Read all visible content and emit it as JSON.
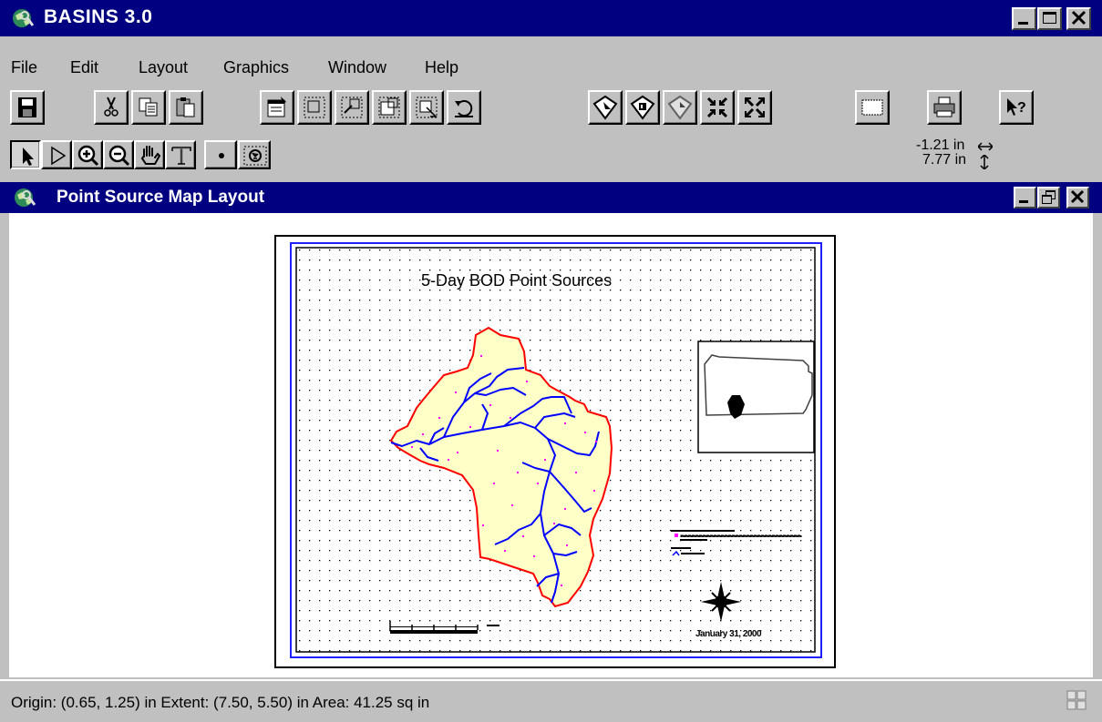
{
  "app": {
    "title": "BASINS 3.0"
  },
  "menu": [
    "File",
    "Edit",
    "Layout",
    "Graphics",
    "Window",
    "Help"
  ],
  "coords": {
    "x": "-1.21 in",
    "y": "7.77 in"
  },
  "child_window": {
    "title": "Point Source Map Layout"
  },
  "layout": {
    "map_title": "5-Day BOD Point Sources",
    "date": "January 31, 2000"
  },
  "status": {
    "text": "Origin: (0.65, 1.25) in  Extent: (7.50, 5.50) in  Area: 41.25 sq in"
  },
  "colors": {
    "titlebar": "#000080",
    "chrome": "#c0c0c0",
    "watershed_fill": "#ffffc8",
    "watershed_outline": "#ff0000",
    "river": "#0000ff",
    "point_source": "#ff00ff"
  },
  "toolbar_icons": [
    "save-icon",
    "cut-icon",
    "copy-icon",
    "paste-icon",
    "properties-icon",
    "group-icon",
    "ungroup-icon",
    "bring-front-icon",
    "send-back-icon",
    "undo-icon",
    "snap-icon",
    "align-icon",
    "size-icon",
    "shrink-icon",
    "expand-icon",
    "blank-icon",
    "print-icon",
    "help-icon"
  ],
  "tool_icons": [
    "pointer-icon",
    "vertex-icon",
    "zoom-in-icon",
    "zoom-out-icon",
    "pan-icon",
    "text-icon",
    "point-icon",
    "frame-icon"
  ]
}
